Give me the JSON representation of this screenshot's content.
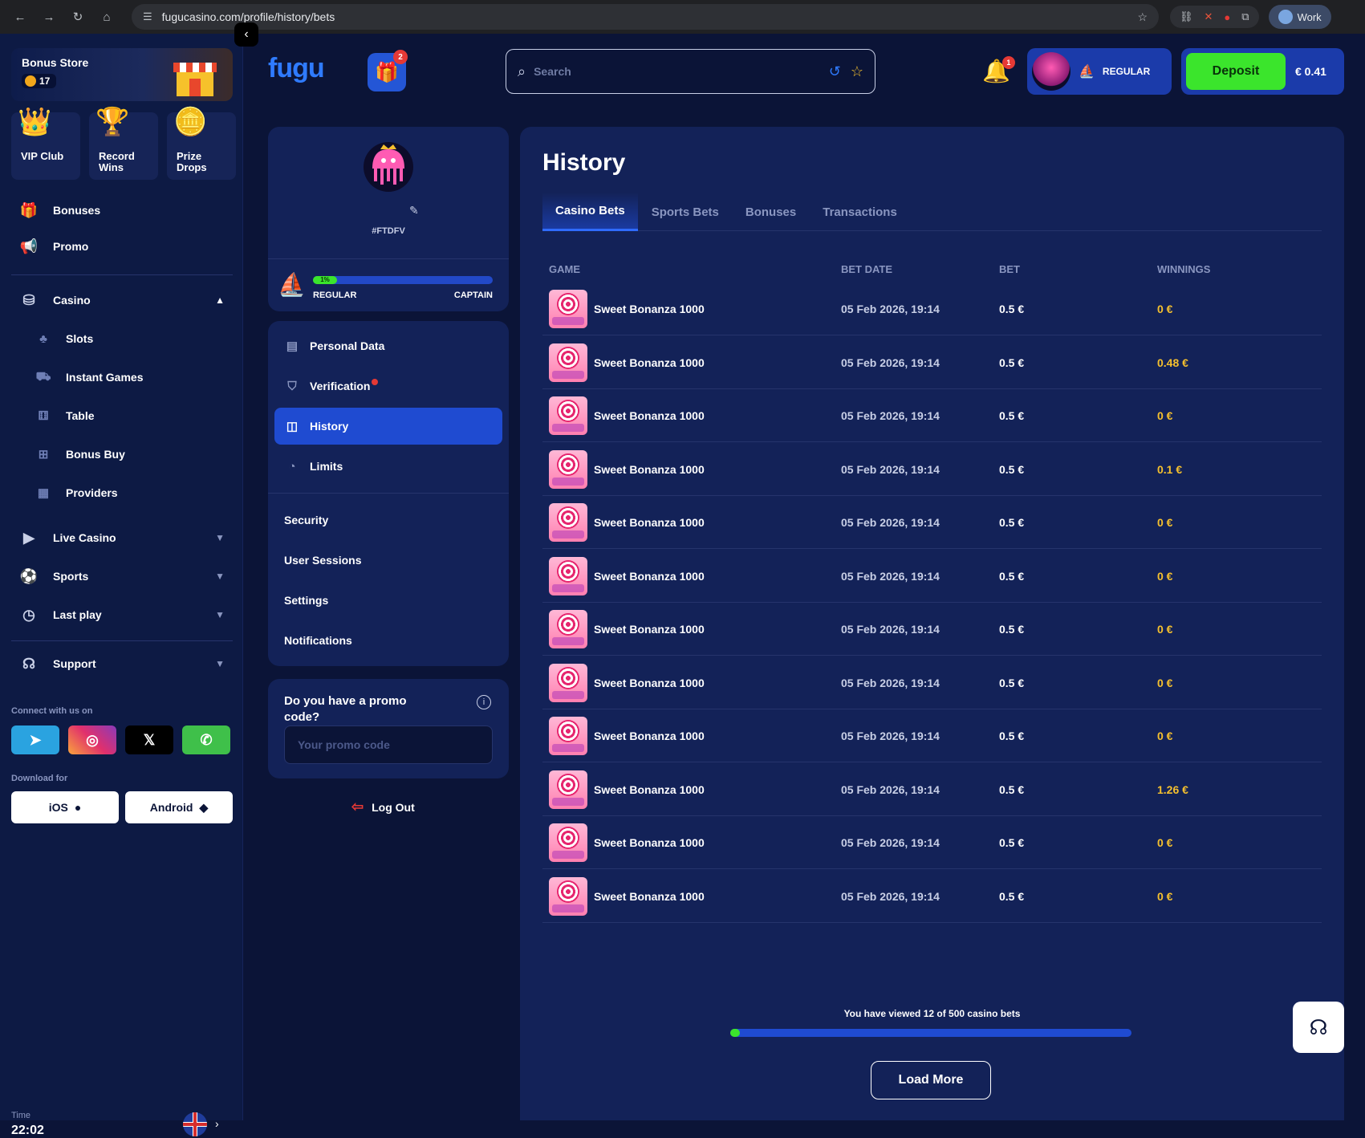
{
  "browser": {
    "url": "fugucasino.com/profile/history/bets",
    "profile": "Work"
  },
  "sidebar": {
    "bonus_store": {
      "title": "Bonus Store",
      "coins": "17"
    },
    "tiles": [
      {
        "label": "VIP Club",
        "icon": "crown-icon"
      },
      {
        "label": "Record Wins",
        "icon": "trophy-podium-icon"
      },
      {
        "label": "Prize Drops",
        "icon": "dollar-coin-icon"
      }
    ],
    "top_items": [
      {
        "label": "Bonuses",
        "icon": "gift-icon"
      },
      {
        "label": "Promo",
        "icon": "megaphone-icon"
      }
    ],
    "casino": {
      "label": "Casino",
      "sub_items": [
        {
          "label": "Slots",
          "icon": "slots-icon"
        },
        {
          "label": "Instant Games",
          "icon": "rocket-icon"
        },
        {
          "label": "Table",
          "icon": "dice-icon"
        },
        {
          "label": "Bonus Buy",
          "icon": "gift-box-icon"
        },
        {
          "label": "Providers",
          "icon": "grid-icon"
        }
      ]
    },
    "groups": [
      {
        "label": "Live Casino",
        "icon": "play-icon"
      },
      {
        "label": "Sports",
        "icon": "ball-icon"
      },
      {
        "label": "Last play",
        "icon": "clock-icon"
      }
    ],
    "support": {
      "label": "Support"
    },
    "connect_label": "Connect with us on",
    "download_label": "Download for",
    "download": {
      "ios": "iOS",
      "android": "Android"
    },
    "time_label": "Time",
    "time_value": "22:02"
  },
  "header": {
    "logo": "fugu",
    "gift_badge": "2",
    "search_placeholder": "Search",
    "bell_badge": "1",
    "level": "REGULAR",
    "deposit_label": "Deposit",
    "balance": "€ 0.41"
  },
  "profile": {
    "tag": "#FTDFV",
    "progress_percent": 1,
    "progress_label": "1%",
    "level_from": "REGULAR",
    "level_to": "CAPTAIN"
  },
  "profile_menu": {
    "items": [
      {
        "label": "Personal Data",
        "icon": "id-card-icon"
      },
      {
        "label": "Verification",
        "icon": "shield-check-icon"
      },
      {
        "label": "History",
        "icon": "history-icon"
      },
      {
        "label": "Limits",
        "icon": "gauge-icon"
      }
    ],
    "text_items": [
      "Security",
      "User Sessions",
      "Settings",
      "Notifications"
    ]
  },
  "promo": {
    "question": "Do you have a promo code?",
    "placeholder": "Your promo code"
  },
  "logout_label": "Log Out",
  "history": {
    "title": "History",
    "tabs": [
      "Casino Bets",
      "Sports Bets",
      "Bonuses",
      "Transactions"
    ],
    "columns": [
      "GAME",
      "BET DATE",
      "BET",
      "WINNINGS"
    ],
    "rows": [
      {
        "game": "Sweet Bonanza 1000",
        "date": "05 Feb 2026, 19:14",
        "bet": "0.5 €",
        "win": "0 €"
      },
      {
        "game": "Sweet Bonanza 1000",
        "date": "05 Feb 2026, 19:14",
        "bet": "0.5 €",
        "win": "0.48 €"
      },
      {
        "game": "Sweet Bonanza 1000",
        "date": "05 Feb 2026, 19:14",
        "bet": "0.5 €",
        "win": "0 €"
      },
      {
        "game": "Sweet Bonanza 1000",
        "date": "05 Feb 2026, 19:14",
        "bet": "0.5 €",
        "win": "0.1 €"
      },
      {
        "game": "Sweet Bonanza 1000",
        "date": "05 Feb 2026, 19:14",
        "bet": "0.5 €",
        "win": "0 €"
      },
      {
        "game": "Sweet Bonanza 1000",
        "date": "05 Feb 2026, 19:14",
        "bet": "0.5 €",
        "win": "0 €"
      },
      {
        "game": "Sweet Bonanza 1000",
        "date": "05 Feb 2026, 19:14",
        "bet": "0.5 €",
        "win": "0 €"
      },
      {
        "game": "Sweet Bonanza 1000",
        "date": "05 Feb 2026, 19:14",
        "bet": "0.5 €",
        "win": "0 €"
      },
      {
        "game": "Sweet Bonanza 1000",
        "date": "05 Feb 2026, 19:14",
        "bet": "0.5 €",
        "win": "0 €"
      },
      {
        "game": "Sweet Bonanza 1000",
        "date": "05 Feb 2026, 19:14",
        "bet": "0.5 €",
        "win": "1.26 €"
      },
      {
        "game": "Sweet Bonanza 1000",
        "date": "05 Feb 2026, 19:14",
        "bet": "0.5 €",
        "win": "0 €"
      },
      {
        "game": "Sweet Bonanza 1000",
        "date": "05 Feb 2026, 19:14",
        "bet": "0.5 €",
        "win": "0 €"
      }
    ],
    "viewed_text": "You have viewed 12 of 500 casino bets",
    "viewed_fraction": 0.024,
    "load_more": "Load More"
  },
  "colors": {
    "bg": "#0b1437",
    "panel": "#132258",
    "accent_blue": "#1f4bd1",
    "deposit_green": "#3be52c",
    "win_yellow": "#f5c02e"
  }
}
